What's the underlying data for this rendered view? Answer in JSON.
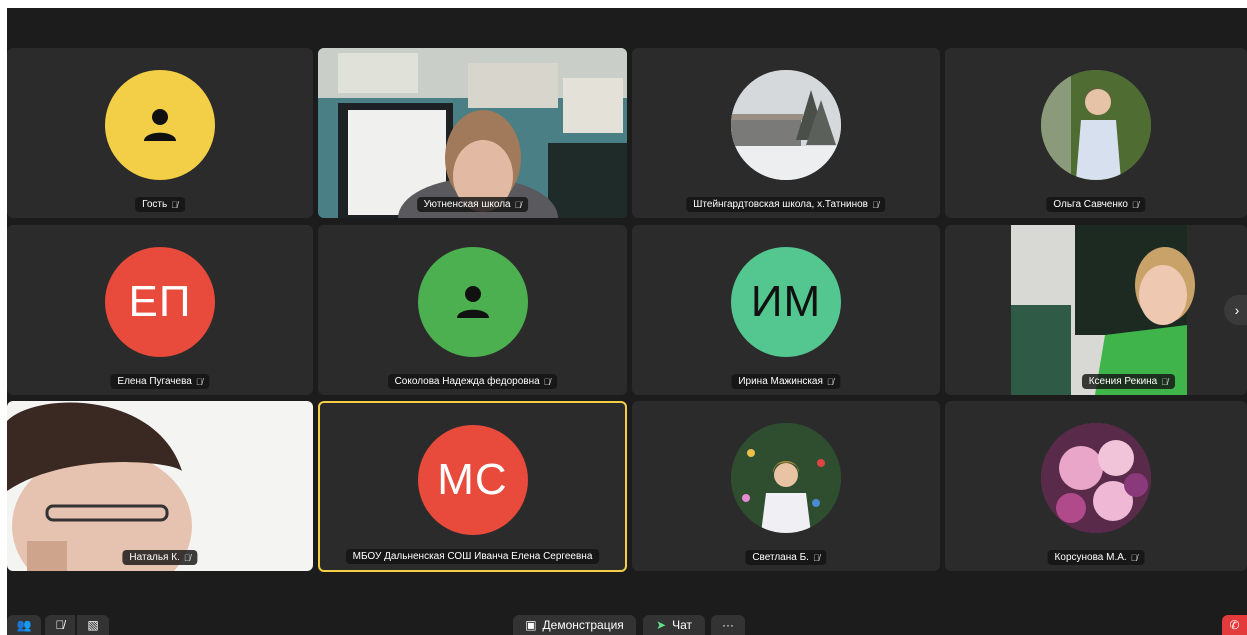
{
  "participants": [
    {
      "name": "Гость",
      "avatar_type": "icon",
      "icon": "person-icon",
      "color": "#f3cf47"
    },
    {
      "name": "Уютненская школа",
      "avatar_type": "video"
    },
    {
      "name": "Штейнгардтовская школа, х.Татнинов",
      "avatar_type": "photo"
    },
    {
      "name": "Ольга Савченко",
      "avatar_type": "photo"
    },
    {
      "name": "Елена Пугачева",
      "avatar_type": "initials",
      "initials": "ЕП",
      "color": "#e84a3c"
    },
    {
      "name": "Соколова Надежда федоровна",
      "avatar_type": "icon",
      "icon": "person-icon",
      "color": "#4caf50"
    },
    {
      "name": "Ирина Мажинская",
      "avatar_type": "initials",
      "initials": "ИМ",
      "color": "#54c690"
    },
    {
      "name": "Ксения Рекина",
      "avatar_type": "video"
    },
    {
      "name": "Наталья К.",
      "avatar_type": "video"
    },
    {
      "name": "МБОУ Дальненская СОШ Иванча Елена Сергеевна",
      "avatar_type": "initials",
      "initials": "МС",
      "color": "#e84a3c",
      "active_speaker": true
    },
    {
      "name": "Светлана Б.",
      "avatar_type": "photo"
    },
    {
      "name": "Корсунова М.А.",
      "avatar_type": "photo"
    }
  ],
  "mute_icon": "mic-off-icon",
  "toolbar": {
    "demo_label": "Демонстрация",
    "chat_label": "Чат",
    "more_label": "···",
    "next_arrow": "›"
  },
  "colors": {
    "background": "#1c1c1c",
    "tile": "#2b2b2b",
    "active_border": "#f3cf47"
  }
}
